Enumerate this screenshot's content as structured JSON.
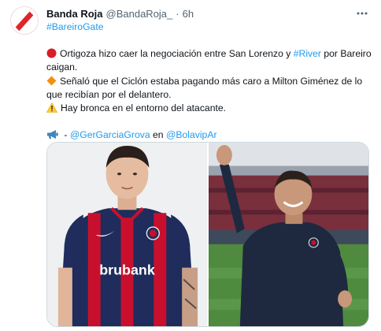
{
  "tweet": {
    "author_name": "Banda Roja",
    "author_handle": "@BandaRoja_",
    "separator": "·",
    "timestamp": "6h",
    "hashtag": "#BareiroGate",
    "line1_text": "Ortigoza hizo caer la negociación entre San Lorenzo y ",
    "line1_link": "#River",
    "line1_rest": " por Bareiro",
    "line2": "caigan.",
    "line3": "Señaló que el Ciclón estaba pagando más caro a Milton Giménez de lo",
    "line4": "que recibían por el delantero.",
    "line5": "Hay bronca en el entorno del atacante.",
    "credit_dash": " - ",
    "credit_user1": "@GerGarciaGrova",
    "credit_en": " en ",
    "credit_user2": "@BolavipAr",
    "sponsor_text": "brubank",
    "icons": {
      "more": "more-horizontal-icon",
      "red_circle": "red-circle-icon",
      "orange_diamond": "orange-diamond-icon",
      "warning": "warning-icon",
      "megaphone": "megaphone-icon"
    },
    "colors": {
      "link": "#1d9bf0",
      "text": "#0f1419",
      "muted": "#536471",
      "brand_red": "#e0242c"
    }
  }
}
